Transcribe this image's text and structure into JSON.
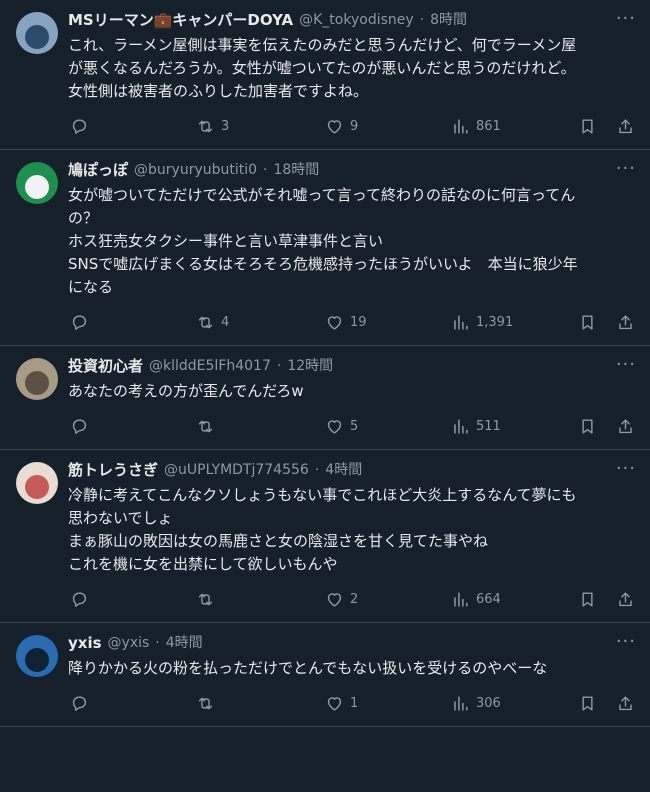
{
  "tweets": [
    {
      "name": "MSリーマン💼キャンパーDOYA",
      "handle": "@K_tokyodisney",
      "time": "8時間",
      "text": "これ、ラーメン屋側は事実を伝えたのみだと思うんだけど、何でラーメン屋\nが悪くなるんだろうか。女性が嘘ついてたのが悪いんだと思うのだけれど。\n女性側は被害者のふりした加害者ですよね。",
      "replies": "",
      "retweets": "3",
      "likes": "9",
      "views": "861",
      "avatar_colors": [
        "#86a3c0",
        "#2c4a6b"
      ]
    },
    {
      "name": "鳩ぽっぽ",
      "handle": "@buryuryubutiti0",
      "time": "18時間",
      "text": "女が嘘ついてただけで公式がそれ嘘って言って終わりの話なのに何言ってん\nの？\nホス狂売女タクシー事件と言い草津事件と言い\nSNSで嘘広げまくる女はそろそろ危機感持ったほうがいいよ　本当に狼少年\nになる",
      "replies": "",
      "retweets": "4",
      "likes": "19",
      "views": "1,391",
      "avatar_colors": [
        "#1e8f4e",
        "#f2f2f2"
      ]
    },
    {
      "name": "投資初心者",
      "handle": "@kllddE5lFh4017",
      "time": "12時間",
      "text": "あなたの考えの方が歪んでんだろw",
      "replies": "",
      "retweets": "",
      "likes": "5",
      "views": "511",
      "avatar_colors": [
        "#a99a86",
        "#5b5145"
      ]
    },
    {
      "name": "筋トレうさぎ",
      "handle": "@uUPLYMDTj774556",
      "time": "4時間",
      "text": "冷静に考えてこんなクソしょうもない事でこれほど大炎上するなんて夢にも\n思わないでしょ\nまぁ豚山の敗因は女の馬鹿さと女の陰湿さを甘く見てた事やね\nこれを機に女を出禁にして欲しいもんや",
      "replies": "",
      "retweets": "",
      "likes": "2",
      "views": "664",
      "avatar_colors": [
        "#e9dcd2",
        "#c45a5a"
      ]
    },
    {
      "name": "yxis",
      "handle": "@yxis",
      "time": "4時間",
      "text": "降りかかる火の粉を払っただけでとんでもない扱いを受けるのやべーな",
      "replies": "",
      "retweets": "",
      "likes": "1",
      "views": "306",
      "avatar_colors": [
        "#2b6cb0",
        "#0e2233"
      ]
    }
  ],
  "icons": {
    "reply": "reply-icon",
    "retweet": "retweet-icon",
    "like": "heart-icon",
    "views": "views-chart-icon",
    "bookmark": "bookmark-icon",
    "share": "share-icon",
    "more": "more-icon"
  },
  "more_glyph": "···"
}
